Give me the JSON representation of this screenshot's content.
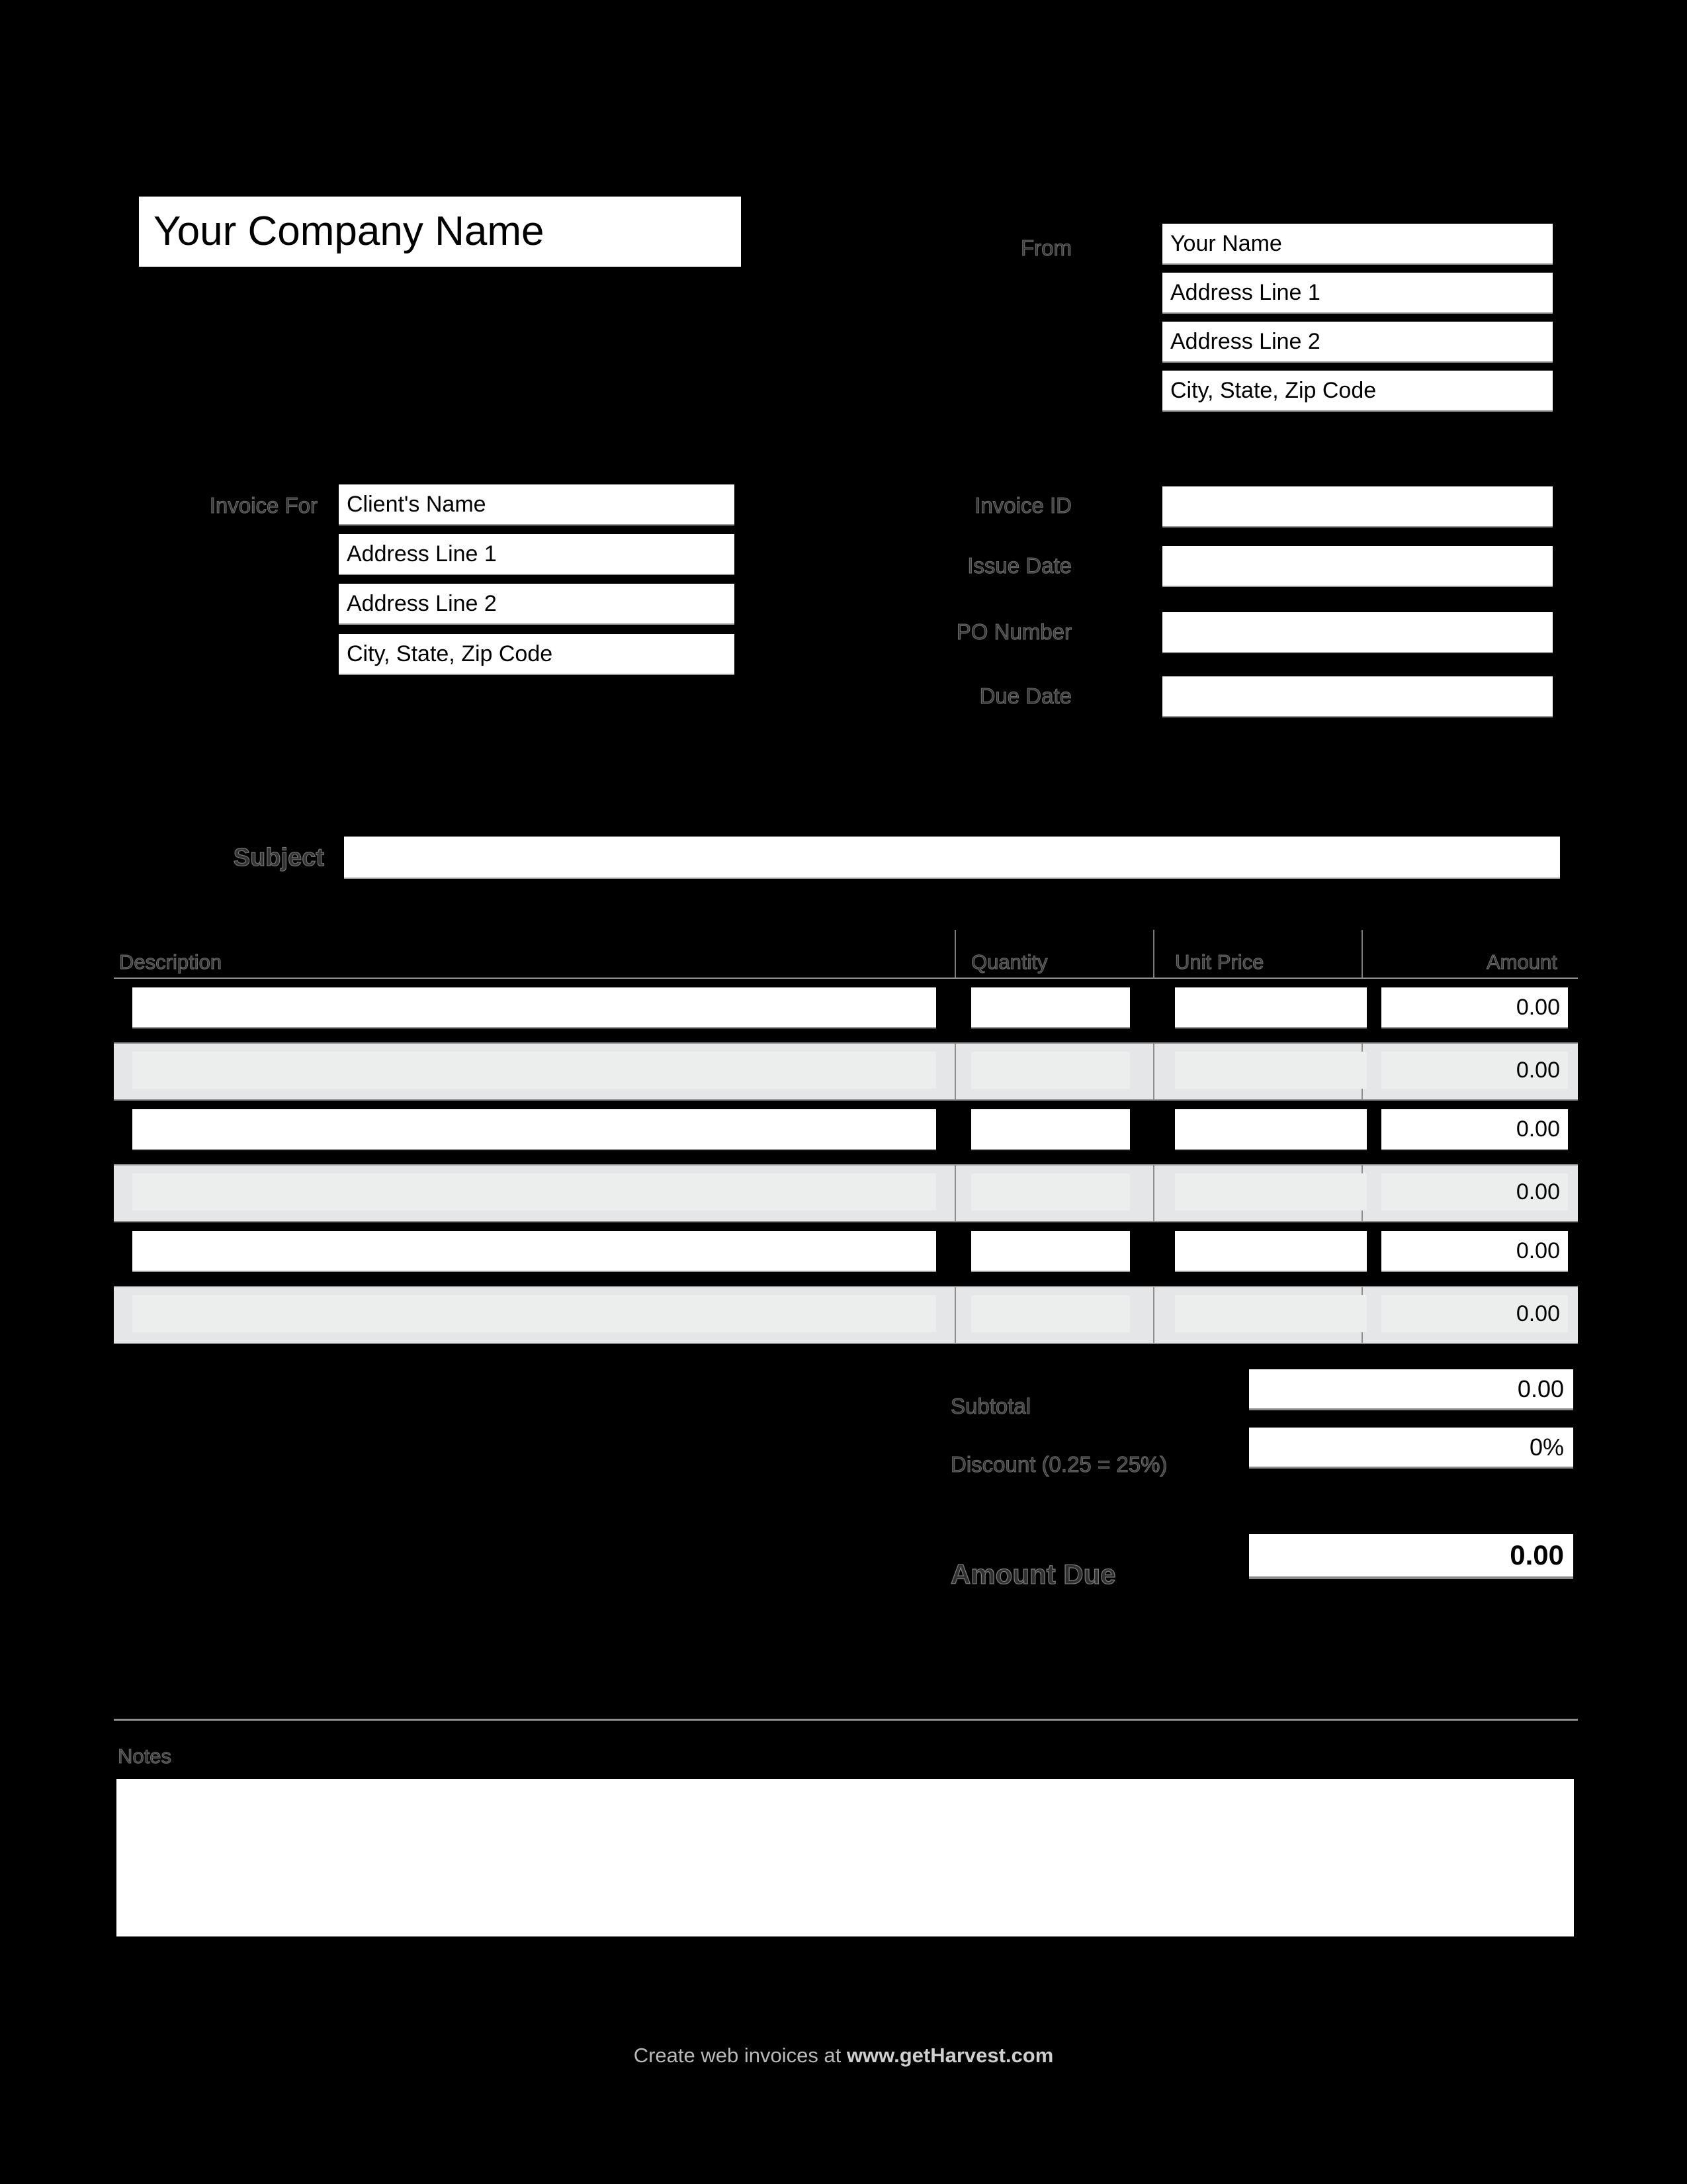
{
  "company": {
    "name": "Your Company Name"
  },
  "from": {
    "label": "From",
    "lines": [
      "Your Name",
      "Address Line 1",
      "Address Line 2",
      "City, State, Zip Code"
    ]
  },
  "invoice_for": {
    "label": "Invoice For",
    "lines": [
      "Client's Name",
      "Address Line 1",
      "Address Line 2",
      "City, State, Zip Code"
    ]
  },
  "meta": {
    "fields": [
      {
        "label": "Invoice ID",
        "value": ""
      },
      {
        "label": "Issue Date",
        "value": ""
      },
      {
        "label": "PO Number",
        "value": ""
      },
      {
        "label": "Due Date",
        "value": ""
      }
    ]
  },
  "subject": {
    "label": "Subject",
    "value": ""
  },
  "table": {
    "headers": [
      "Description",
      "Quantity",
      "Unit Price",
      "Amount"
    ],
    "rows": [
      {
        "description": "",
        "quantity": "",
        "unit_price": "",
        "amount": "0.00"
      },
      {
        "description": "",
        "quantity": "",
        "unit_price": "",
        "amount": "0.00"
      },
      {
        "description": "",
        "quantity": "",
        "unit_price": "",
        "amount": "0.00"
      },
      {
        "description": "",
        "quantity": "",
        "unit_price": "",
        "amount": "0.00"
      },
      {
        "description": "",
        "quantity": "",
        "unit_price": "",
        "amount": "0.00"
      },
      {
        "description": "",
        "quantity": "",
        "unit_price": "",
        "amount": "0.00"
      }
    ]
  },
  "totals": {
    "subtotal_label": "Subtotal",
    "subtotal_value": "0.00",
    "discount_label": "Discount (0.25 = 25%)",
    "discount_value": "0%",
    "amount_due_label": "Amount Due",
    "amount_due_value": "0.00"
  },
  "notes": {
    "label": "Notes",
    "value": ""
  },
  "footer": {
    "prefix": "Create web invoices at ",
    "domain": "www.getHarvest.com"
  },
  "colors": {
    "background": "#000000",
    "field_background": "#ffffff",
    "stripe_row": "#e4e6e8",
    "label_text": "#3a3a3a",
    "rule": "#8e8e8e",
    "footer_text": "#b9b9b9"
  }
}
